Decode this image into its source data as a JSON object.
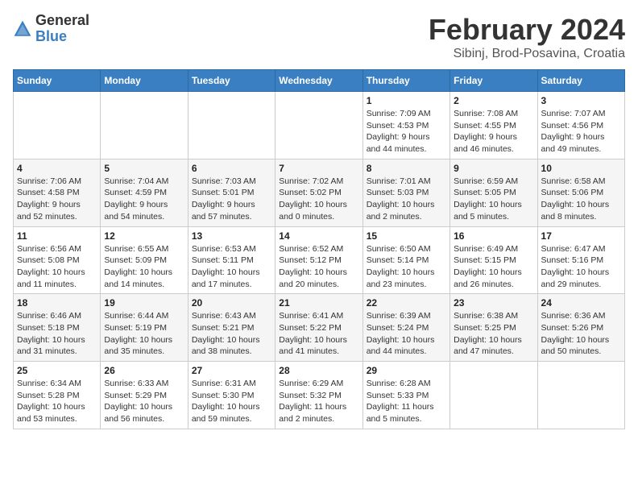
{
  "header": {
    "logo_general": "General",
    "logo_blue": "Blue",
    "month_title": "February 2024",
    "location": "Sibinj, Brod-Posavina, Croatia"
  },
  "days_of_week": [
    "Sunday",
    "Monday",
    "Tuesday",
    "Wednesday",
    "Thursday",
    "Friday",
    "Saturday"
  ],
  "weeks": [
    [
      {
        "day": "",
        "info": ""
      },
      {
        "day": "",
        "info": ""
      },
      {
        "day": "",
        "info": ""
      },
      {
        "day": "",
        "info": ""
      },
      {
        "day": "1",
        "info": "Sunrise: 7:09 AM\nSunset: 4:53 PM\nDaylight: 9 hours\nand 44 minutes."
      },
      {
        "day": "2",
        "info": "Sunrise: 7:08 AM\nSunset: 4:55 PM\nDaylight: 9 hours\nand 46 minutes."
      },
      {
        "day": "3",
        "info": "Sunrise: 7:07 AM\nSunset: 4:56 PM\nDaylight: 9 hours\nand 49 minutes."
      }
    ],
    [
      {
        "day": "4",
        "info": "Sunrise: 7:06 AM\nSunset: 4:58 PM\nDaylight: 9 hours\nand 52 minutes."
      },
      {
        "day": "5",
        "info": "Sunrise: 7:04 AM\nSunset: 4:59 PM\nDaylight: 9 hours\nand 54 minutes."
      },
      {
        "day": "6",
        "info": "Sunrise: 7:03 AM\nSunset: 5:01 PM\nDaylight: 9 hours\nand 57 minutes."
      },
      {
        "day": "7",
        "info": "Sunrise: 7:02 AM\nSunset: 5:02 PM\nDaylight: 10 hours\nand 0 minutes."
      },
      {
        "day": "8",
        "info": "Sunrise: 7:01 AM\nSunset: 5:03 PM\nDaylight: 10 hours\nand 2 minutes."
      },
      {
        "day": "9",
        "info": "Sunrise: 6:59 AM\nSunset: 5:05 PM\nDaylight: 10 hours\nand 5 minutes."
      },
      {
        "day": "10",
        "info": "Sunrise: 6:58 AM\nSunset: 5:06 PM\nDaylight: 10 hours\nand 8 minutes."
      }
    ],
    [
      {
        "day": "11",
        "info": "Sunrise: 6:56 AM\nSunset: 5:08 PM\nDaylight: 10 hours\nand 11 minutes."
      },
      {
        "day": "12",
        "info": "Sunrise: 6:55 AM\nSunset: 5:09 PM\nDaylight: 10 hours\nand 14 minutes."
      },
      {
        "day": "13",
        "info": "Sunrise: 6:53 AM\nSunset: 5:11 PM\nDaylight: 10 hours\nand 17 minutes."
      },
      {
        "day": "14",
        "info": "Sunrise: 6:52 AM\nSunset: 5:12 PM\nDaylight: 10 hours\nand 20 minutes."
      },
      {
        "day": "15",
        "info": "Sunrise: 6:50 AM\nSunset: 5:14 PM\nDaylight: 10 hours\nand 23 minutes."
      },
      {
        "day": "16",
        "info": "Sunrise: 6:49 AM\nSunset: 5:15 PM\nDaylight: 10 hours\nand 26 minutes."
      },
      {
        "day": "17",
        "info": "Sunrise: 6:47 AM\nSunset: 5:16 PM\nDaylight: 10 hours\nand 29 minutes."
      }
    ],
    [
      {
        "day": "18",
        "info": "Sunrise: 6:46 AM\nSunset: 5:18 PM\nDaylight: 10 hours\nand 31 minutes."
      },
      {
        "day": "19",
        "info": "Sunrise: 6:44 AM\nSunset: 5:19 PM\nDaylight: 10 hours\nand 35 minutes."
      },
      {
        "day": "20",
        "info": "Sunrise: 6:43 AM\nSunset: 5:21 PM\nDaylight: 10 hours\nand 38 minutes."
      },
      {
        "day": "21",
        "info": "Sunrise: 6:41 AM\nSunset: 5:22 PM\nDaylight: 10 hours\nand 41 minutes."
      },
      {
        "day": "22",
        "info": "Sunrise: 6:39 AM\nSunset: 5:24 PM\nDaylight: 10 hours\nand 44 minutes."
      },
      {
        "day": "23",
        "info": "Sunrise: 6:38 AM\nSunset: 5:25 PM\nDaylight: 10 hours\nand 47 minutes."
      },
      {
        "day": "24",
        "info": "Sunrise: 6:36 AM\nSunset: 5:26 PM\nDaylight: 10 hours\nand 50 minutes."
      }
    ],
    [
      {
        "day": "25",
        "info": "Sunrise: 6:34 AM\nSunset: 5:28 PM\nDaylight: 10 hours\nand 53 minutes."
      },
      {
        "day": "26",
        "info": "Sunrise: 6:33 AM\nSunset: 5:29 PM\nDaylight: 10 hours\nand 56 minutes."
      },
      {
        "day": "27",
        "info": "Sunrise: 6:31 AM\nSunset: 5:30 PM\nDaylight: 10 hours\nand 59 minutes."
      },
      {
        "day": "28",
        "info": "Sunrise: 6:29 AM\nSunset: 5:32 PM\nDaylight: 11 hours\nand 2 minutes."
      },
      {
        "day": "29",
        "info": "Sunrise: 6:28 AM\nSunset: 5:33 PM\nDaylight: 11 hours\nand 5 minutes."
      },
      {
        "day": "",
        "info": ""
      },
      {
        "day": "",
        "info": ""
      }
    ]
  ]
}
